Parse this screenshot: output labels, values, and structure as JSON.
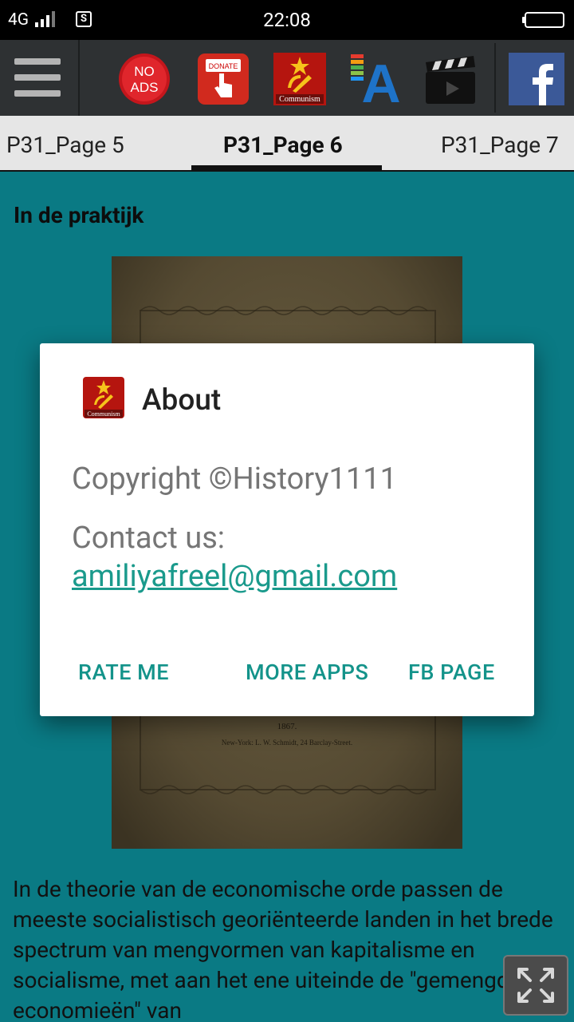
{
  "status_bar": {
    "network": "4G",
    "time": "22:08",
    "sim_glyph": "S"
  },
  "toolbar": {
    "icons": [
      {
        "name": "no-ads-icon",
        "label": "NO ADS"
      },
      {
        "name": "donate-icon",
        "label": "DONATE"
      },
      {
        "name": "communism-icon",
        "label": "Communism"
      },
      {
        "name": "font-size-icon",
        "label": "A"
      },
      {
        "name": "video-icon"
      },
      {
        "name": "facebook-icon",
        "label": "f"
      }
    ]
  },
  "tabs": [
    {
      "label": "P31_Page 5",
      "active": false
    },
    {
      "label": "P31_Page 6",
      "active": true
    },
    {
      "label": "P31_Page 7",
      "active": false
    }
  ],
  "content": {
    "title": "In de praktijk",
    "image_caption_year": "1867.",
    "image_caption_publisher": "New-York: L. W. Schmidt, 24 Barclay-Street.",
    "paragraph": "In de theorie van de economische orde passen de meeste socialistisch georiënteerde landen in het brede spectrum van mengvormen van kapitalisme en socialisme, met aan het ene uiteinde de \"gemengde economieën\" van"
  },
  "dialog": {
    "title": "About",
    "icon_label": "Communism",
    "copyright": "Copyright ©History1111",
    "contact_label": "Contact us:",
    "email": "amiliyafreel@gmail.com",
    "buttons": {
      "rate": "RATE ME",
      "more_apps": "MORE APPS",
      "fb_page": "FB PAGE"
    }
  },
  "colors": {
    "background_teal": "#0a7a84",
    "accent": "#13938a",
    "toolbar": "#2e3133"
  }
}
